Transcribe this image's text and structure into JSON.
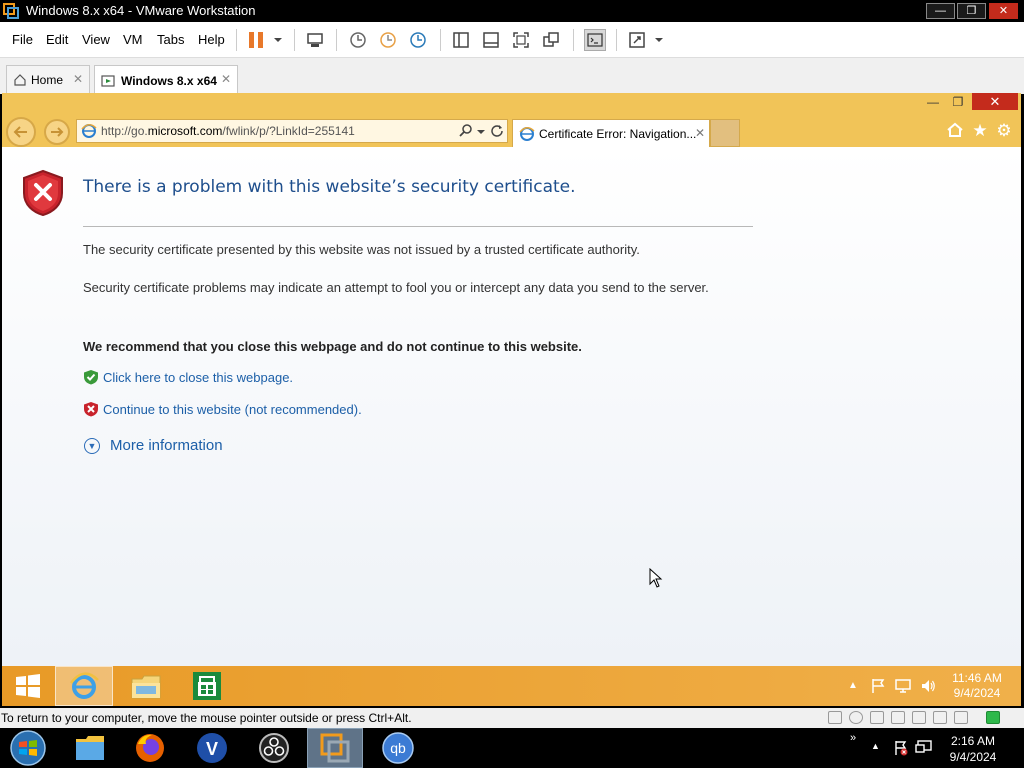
{
  "vmware": {
    "title": "Windows 8.x x64 - VMware Workstation",
    "menu": [
      "File",
      "Edit",
      "View",
      "VM",
      "Tabs",
      "Help"
    ],
    "tabs": [
      {
        "label": "Home"
      },
      {
        "label": "Windows 8.x x64"
      }
    ],
    "status_message": "To return to your computer, move the mouse pointer outside or press Ctrl+Alt."
  },
  "ie": {
    "address_prefix": "http://go.",
    "address_domain": "microsoft.com",
    "address_path": "/fwlink/p/?LinkId=255141",
    "tab_label": "Certificate Error: Navigation...",
    "accent_color": "#f1c458"
  },
  "page": {
    "title": "There is a problem with this website’s security certificate.",
    "para1": "The security certificate presented by this website was not issued by a trusted certificate authority.",
    "para2": "Security certificate problems may indicate an attempt to fool you or intercept any data you send to the server.",
    "recommendation": "We recommend that you close this webpage and do not continue to this website.",
    "close_link": "Click here to close this webpage.",
    "continue_link": "Continue to this website (not recommended).",
    "more_info": "More information"
  },
  "guest_taskbar": {
    "time": "11:46 AM",
    "date": "9/4/2024",
    "apps": [
      "start-icon",
      "internet-explorer-icon",
      "file-explorer-icon",
      "store-icon"
    ]
  },
  "host_taskbar": {
    "time": "2:16 AM",
    "date": "9/4/2024",
    "apps": [
      "start-orb-icon",
      "folder-icon",
      "firefox-icon",
      "v-app-icon",
      "obs-icon",
      "vmware-icon",
      "qbittorrent-icon"
    ],
    "qb_label": "qb",
    "v_label": "V"
  }
}
